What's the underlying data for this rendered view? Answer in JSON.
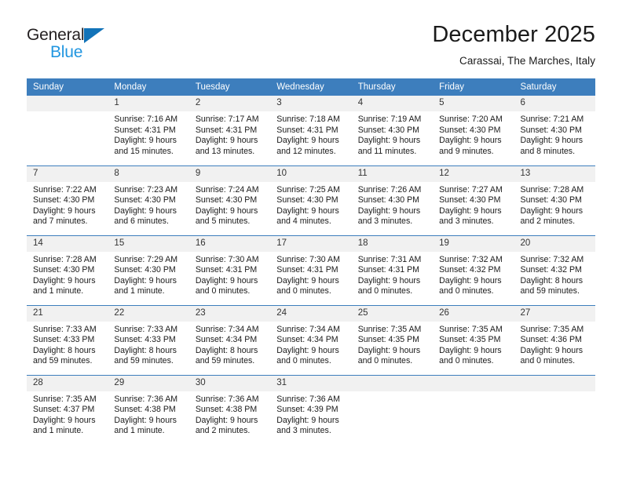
{
  "brand": {
    "line1": "General",
    "line2": "Blue",
    "triangle_color": "#1273b8",
    "line2_color": "#2196e0"
  },
  "header": {
    "month_title": "December 2025",
    "location": "Carassai, The Marches, Italy"
  },
  "calendar": {
    "header_bg": "#3d7ebd",
    "daynum_bg": "#f1f1f1",
    "weekday_headers": [
      "Sunday",
      "Monday",
      "Tuesday",
      "Wednesday",
      "Thursday",
      "Friday",
      "Saturday"
    ],
    "weeks": [
      [
        {
          "day": "",
          "lines": []
        },
        {
          "day": "1",
          "lines": [
            "Sunrise: 7:16 AM",
            "Sunset: 4:31 PM",
            "Daylight: 9 hours",
            "and 15 minutes."
          ]
        },
        {
          "day": "2",
          "lines": [
            "Sunrise: 7:17 AM",
            "Sunset: 4:31 PM",
            "Daylight: 9 hours",
            "and 13 minutes."
          ]
        },
        {
          "day": "3",
          "lines": [
            "Sunrise: 7:18 AM",
            "Sunset: 4:31 PM",
            "Daylight: 9 hours",
            "and 12 minutes."
          ]
        },
        {
          "day": "4",
          "lines": [
            "Sunrise: 7:19 AM",
            "Sunset: 4:30 PM",
            "Daylight: 9 hours",
            "and 11 minutes."
          ]
        },
        {
          "day": "5",
          "lines": [
            "Sunrise: 7:20 AM",
            "Sunset: 4:30 PM",
            "Daylight: 9 hours",
            "and 9 minutes."
          ]
        },
        {
          "day": "6",
          "lines": [
            "Sunrise: 7:21 AM",
            "Sunset: 4:30 PM",
            "Daylight: 9 hours",
            "and 8 minutes."
          ]
        }
      ],
      [
        {
          "day": "7",
          "lines": [
            "Sunrise: 7:22 AM",
            "Sunset: 4:30 PM",
            "Daylight: 9 hours",
            "and 7 minutes."
          ]
        },
        {
          "day": "8",
          "lines": [
            "Sunrise: 7:23 AM",
            "Sunset: 4:30 PM",
            "Daylight: 9 hours",
            "and 6 minutes."
          ]
        },
        {
          "day": "9",
          "lines": [
            "Sunrise: 7:24 AM",
            "Sunset: 4:30 PM",
            "Daylight: 9 hours",
            "and 5 minutes."
          ]
        },
        {
          "day": "10",
          "lines": [
            "Sunrise: 7:25 AM",
            "Sunset: 4:30 PM",
            "Daylight: 9 hours",
            "and 4 minutes."
          ]
        },
        {
          "day": "11",
          "lines": [
            "Sunrise: 7:26 AM",
            "Sunset: 4:30 PM",
            "Daylight: 9 hours",
            "and 3 minutes."
          ]
        },
        {
          "day": "12",
          "lines": [
            "Sunrise: 7:27 AM",
            "Sunset: 4:30 PM",
            "Daylight: 9 hours",
            "and 3 minutes."
          ]
        },
        {
          "day": "13",
          "lines": [
            "Sunrise: 7:28 AM",
            "Sunset: 4:30 PM",
            "Daylight: 9 hours",
            "and 2 minutes."
          ]
        }
      ],
      [
        {
          "day": "14",
          "lines": [
            "Sunrise: 7:28 AM",
            "Sunset: 4:30 PM",
            "Daylight: 9 hours",
            "and 1 minute."
          ]
        },
        {
          "day": "15",
          "lines": [
            "Sunrise: 7:29 AM",
            "Sunset: 4:30 PM",
            "Daylight: 9 hours",
            "and 1 minute."
          ]
        },
        {
          "day": "16",
          "lines": [
            "Sunrise: 7:30 AM",
            "Sunset: 4:31 PM",
            "Daylight: 9 hours",
            "and 0 minutes."
          ]
        },
        {
          "day": "17",
          "lines": [
            "Sunrise: 7:30 AM",
            "Sunset: 4:31 PM",
            "Daylight: 9 hours",
            "and 0 minutes."
          ]
        },
        {
          "day": "18",
          "lines": [
            "Sunrise: 7:31 AM",
            "Sunset: 4:31 PM",
            "Daylight: 9 hours",
            "and 0 minutes."
          ]
        },
        {
          "day": "19",
          "lines": [
            "Sunrise: 7:32 AM",
            "Sunset: 4:32 PM",
            "Daylight: 9 hours",
            "and 0 minutes."
          ]
        },
        {
          "day": "20",
          "lines": [
            "Sunrise: 7:32 AM",
            "Sunset: 4:32 PM",
            "Daylight: 8 hours",
            "and 59 minutes."
          ]
        }
      ],
      [
        {
          "day": "21",
          "lines": [
            "Sunrise: 7:33 AM",
            "Sunset: 4:33 PM",
            "Daylight: 8 hours",
            "and 59 minutes."
          ]
        },
        {
          "day": "22",
          "lines": [
            "Sunrise: 7:33 AM",
            "Sunset: 4:33 PM",
            "Daylight: 8 hours",
            "and 59 minutes."
          ]
        },
        {
          "day": "23",
          "lines": [
            "Sunrise: 7:34 AM",
            "Sunset: 4:34 PM",
            "Daylight: 8 hours",
            "and 59 minutes."
          ]
        },
        {
          "day": "24",
          "lines": [
            "Sunrise: 7:34 AM",
            "Sunset: 4:34 PM",
            "Daylight: 9 hours",
            "and 0 minutes."
          ]
        },
        {
          "day": "25",
          "lines": [
            "Sunrise: 7:35 AM",
            "Sunset: 4:35 PM",
            "Daylight: 9 hours",
            "and 0 minutes."
          ]
        },
        {
          "day": "26",
          "lines": [
            "Sunrise: 7:35 AM",
            "Sunset: 4:35 PM",
            "Daylight: 9 hours",
            "and 0 minutes."
          ]
        },
        {
          "day": "27",
          "lines": [
            "Sunrise: 7:35 AM",
            "Sunset: 4:36 PM",
            "Daylight: 9 hours",
            "and 0 minutes."
          ]
        }
      ],
      [
        {
          "day": "28",
          "lines": [
            "Sunrise: 7:35 AM",
            "Sunset: 4:37 PM",
            "Daylight: 9 hours",
            "and 1 minute."
          ]
        },
        {
          "day": "29",
          "lines": [
            "Sunrise: 7:36 AM",
            "Sunset: 4:38 PM",
            "Daylight: 9 hours",
            "and 1 minute."
          ]
        },
        {
          "day": "30",
          "lines": [
            "Sunrise: 7:36 AM",
            "Sunset: 4:38 PM",
            "Daylight: 9 hours",
            "and 2 minutes."
          ]
        },
        {
          "day": "31",
          "lines": [
            "Sunrise: 7:36 AM",
            "Sunset: 4:39 PM",
            "Daylight: 9 hours",
            "and 3 minutes."
          ]
        },
        {
          "day": "",
          "lines": []
        },
        {
          "day": "",
          "lines": []
        },
        {
          "day": "",
          "lines": []
        }
      ]
    ]
  }
}
